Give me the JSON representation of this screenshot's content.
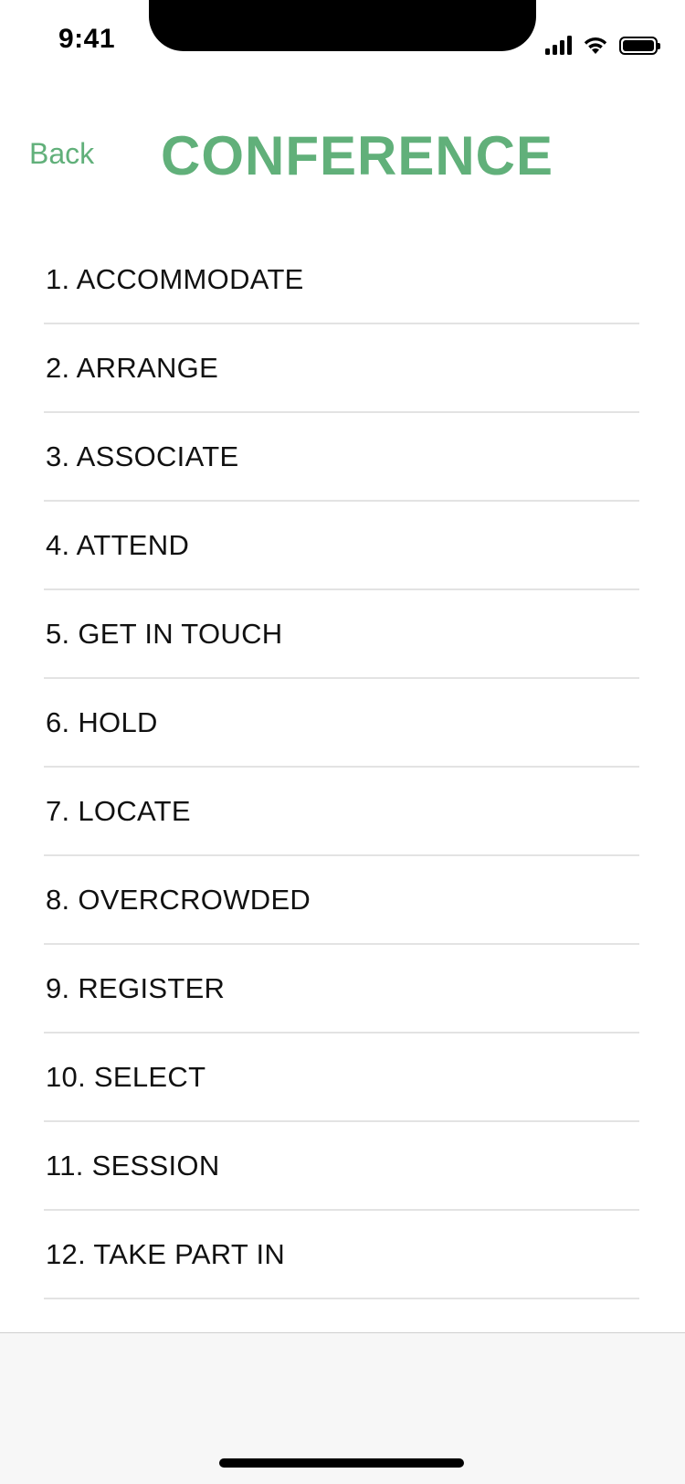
{
  "status_bar": {
    "time": "9:41"
  },
  "nav": {
    "back_label": "Back",
    "title": "CONFERENCE"
  },
  "colors": {
    "accent": "#61b07a",
    "divider": "#e3e3e3",
    "bottom_bar": "#f7f7f7"
  },
  "list": {
    "items": [
      {
        "label": "1. ACCOMMODATE"
      },
      {
        "label": "2. ARRANGE"
      },
      {
        "label": "3. ASSOCIATE"
      },
      {
        "label": "4. ATTEND"
      },
      {
        "label": "5. GET IN TOUCH"
      },
      {
        "label": "6. HOLD"
      },
      {
        "label": "7. LOCATE"
      },
      {
        "label": "8. OVERCROWDED"
      },
      {
        "label": "9. REGISTER"
      },
      {
        "label": "10. SELECT"
      },
      {
        "label": "11. SESSION"
      },
      {
        "label": "12. TAKE PART IN"
      }
    ]
  },
  "icons": {
    "signal": "cellular-signal-icon",
    "wifi": "wifi-icon",
    "battery": "battery-icon"
  }
}
